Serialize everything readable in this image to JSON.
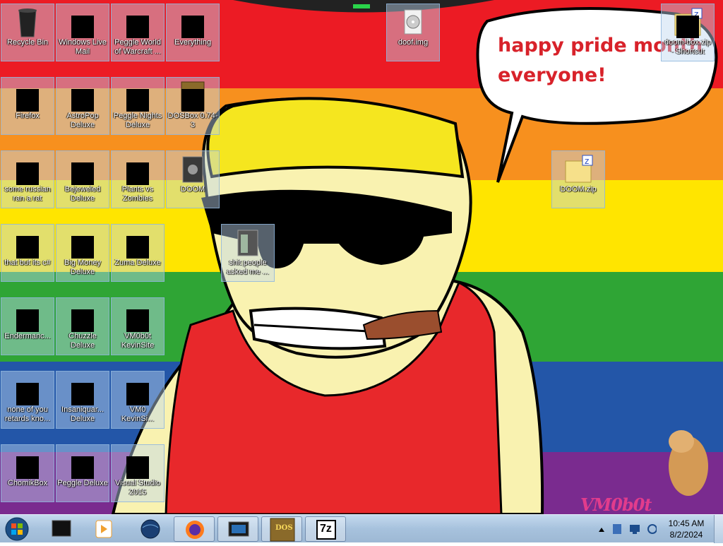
{
  "wallpaper": {
    "stripes": [
      "#ec1b24",
      "#f7901e",
      "#ffe500",
      "#2fa535",
      "#2356a8",
      "#7a2b8f"
    ],
    "speech_bubble_text_line1": "happy pride month",
    "speech_bubble_text_line2": "everyone!",
    "signature": "VM0b0t"
  },
  "desktop_icons": [
    {
      "label": "Recycle Bin",
      "icon": "recycle-bin-icon"
    },
    {
      "label": "Windows Live Mail",
      "icon": "mail-icon"
    },
    {
      "label": "Peggle World of Warcraft ...",
      "icon": "peggle-wow-icon"
    },
    {
      "label": "Everything",
      "icon": "everything-search-icon"
    },
    {
      "label": "doof.img",
      "icon": "disk-image-icon"
    },
    {
      "label": "doom-box.zip - Shortcut",
      "icon": "zip-folder-icon"
    },
    {
      "label": "Firefox",
      "icon": "firefox-icon"
    },
    {
      "label": "AstroPop Deluxe",
      "icon": "astropop-icon"
    },
    {
      "label": "Peggle Nights Deluxe",
      "icon": "peggle-nights-icon"
    },
    {
      "label": "DOSBox 0.74-3",
      "icon": "dosbox-icon"
    },
    {
      "label": "some russian ran a rat",
      "icon": "executable-icon"
    },
    {
      "label": "Bejeweled Deluxe",
      "icon": "bejeweled-icon"
    },
    {
      "label": "Plants vs Zombies",
      "icon": "plants-vs-zombies-icon"
    },
    {
      "label": "DOOM",
      "icon": "doom-icon"
    },
    {
      "label": "DOOM.zip",
      "icon": "zip-folder-icon"
    },
    {
      "label": "that but its c#",
      "icon": "windows-stack-icon"
    },
    {
      "label": "Big Money Deluxe",
      "icon": "big-money-icon"
    },
    {
      "label": "Zuma Deluxe",
      "icon": "zuma-icon"
    },
    {
      "label": "shit people asked me ...",
      "icon": "folder-icon"
    },
    {
      "label": "Endermanc...",
      "icon": "terminal-icon"
    },
    {
      "label": "Chuzzle Deluxe",
      "icon": "chuzzle-icon"
    },
    {
      "label": "VM0b0t KevinSite",
      "icon": "website-icon"
    },
    {
      "label": "none of you retards kno...",
      "icon": "app-icon"
    },
    {
      "label": "Insaniquar... Deluxe",
      "icon": "insaniquarium-icon"
    },
    {
      "label": "VM0 KevinSi...",
      "icon": "website-icon"
    },
    {
      "label": "ChomikBox",
      "icon": "chomikbox-icon"
    },
    {
      "label": "Peggle Deluxe",
      "icon": "peggle-icon"
    },
    {
      "label": "Visual Studio 2015",
      "icon": "visual-studio-icon"
    }
  ],
  "taskbar": {
    "start_icon": "windows-orb-icon",
    "pinned": [
      {
        "icon": "black-box-app-icon"
      },
      {
        "icon": "media-player-icon"
      },
      {
        "icon": "globe-icon"
      },
      {
        "icon": "firefox-icon"
      },
      {
        "icon": "monitor-app-icon"
      },
      {
        "icon": "dosbox-icon"
      },
      {
        "icon": "7zip-icon"
      }
    ],
    "sevenzip_label": "7z",
    "dosbox_label": "DOS",
    "tray_icons": [
      "chevron-up-icon",
      "network-icon",
      "display-icon",
      "volume-icon"
    ],
    "time": "10:45 AM",
    "date": "8/2/2024"
  }
}
